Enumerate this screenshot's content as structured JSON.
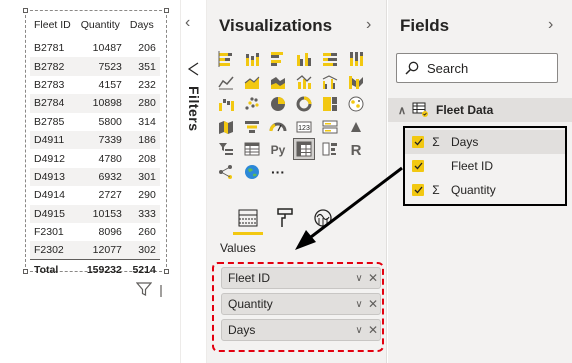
{
  "table": {
    "headers": [
      "Fleet ID",
      "Quantity",
      "Days"
    ],
    "rows": [
      [
        "B2781",
        "10487",
        "206"
      ],
      [
        "B2782",
        "7523",
        "351"
      ],
      [
        "B2783",
        "4157",
        "232"
      ],
      [
        "B2784",
        "10898",
        "280"
      ],
      [
        "B2785",
        "5800",
        "314"
      ],
      [
        "D4911",
        "7339",
        "186"
      ],
      [
        "D4912",
        "4780",
        "208"
      ],
      [
        "D4913",
        "6932",
        "301"
      ],
      [
        "D4914",
        "2727",
        "290"
      ],
      [
        "D4915",
        "10153",
        "333"
      ],
      [
        "F2301",
        "8096",
        "260"
      ],
      [
        "F2302",
        "12077",
        "302"
      ]
    ],
    "total": [
      "Total",
      "159232",
      "5214"
    ]
  },
  "filters": {
    "label": "Filters",
    "collapse_glyph": "‹"
  },
  "visualizations": {
    "title": "Visualizations",
    "expand_glyph": "›",
    "icons": [
      "stacked-bar-chart-icon",
      "stacked-column-chart-icon",
      "clustered-bar-chart-icon",
      "clustered-column-chart-icon",
      "100-stacked-bar-chart-icon",
      "100-stacked-column-chart-icon",
      "line-chart-icon",
      "area-chart-icon",
      "stacked-area-chart-icon",
      "line-and-column-chart-icon",
      "line-and-clustered-column-chart-icon",
      "ribbon-chart-icon",
      "waterfall-chart-icon",
      "scatter-chart-icon",
      "pie-chart-icon",
      "donut-chart-icon",
      "treemap-icon",
      "map-icon",
      "filled-map-icon",
      "funnel-icon",
      "gauge-icon",
      "card-icon",
      "multi-row-card-icon",
      "kpi-icon",
      "slicer-icon",
      "table-icon",
      "python-visual-icon",
      "matrix-icon",
      "key-influencers-icon",
      "r-visual-icon",
      "decomposition-tree-icon",
      "globe-icon",
      "more-visuals-icon"
    ],
    "python_label": "Py",
    "r_label": "R",
    "more_label": "···",
    "values_label": "Values",
    "wells": [
      {
        "label": "Fleet ID"
      },
      {
        "label": "Quantity"
      },
      {
        "label": "Days"
      }
    ],
    "well_chevron": "∨",
    "well_remove": "✕"
  },
  "fields": {
    "title": "Fields",
    "expand_glyph": "›",
    "search_placeholder": "Search",
    "table_name": "Fleet Data",
    "table_chevron": "∧",
    "items": [
      {
        "name": "Days",
        "sigma": "Σ"
      },
      {
        "name": "Fleet ID",
        "sigma": ""
      },
      {
        "name": "Quantity",
        "sigma": "Σ"
      }
    ]
  },
  "colors": {
    "accent_yellow": "#f2c811",
    "highlight_red": "#e3000f",
    "pane_bg": "#f3f2f1"
  }
}
